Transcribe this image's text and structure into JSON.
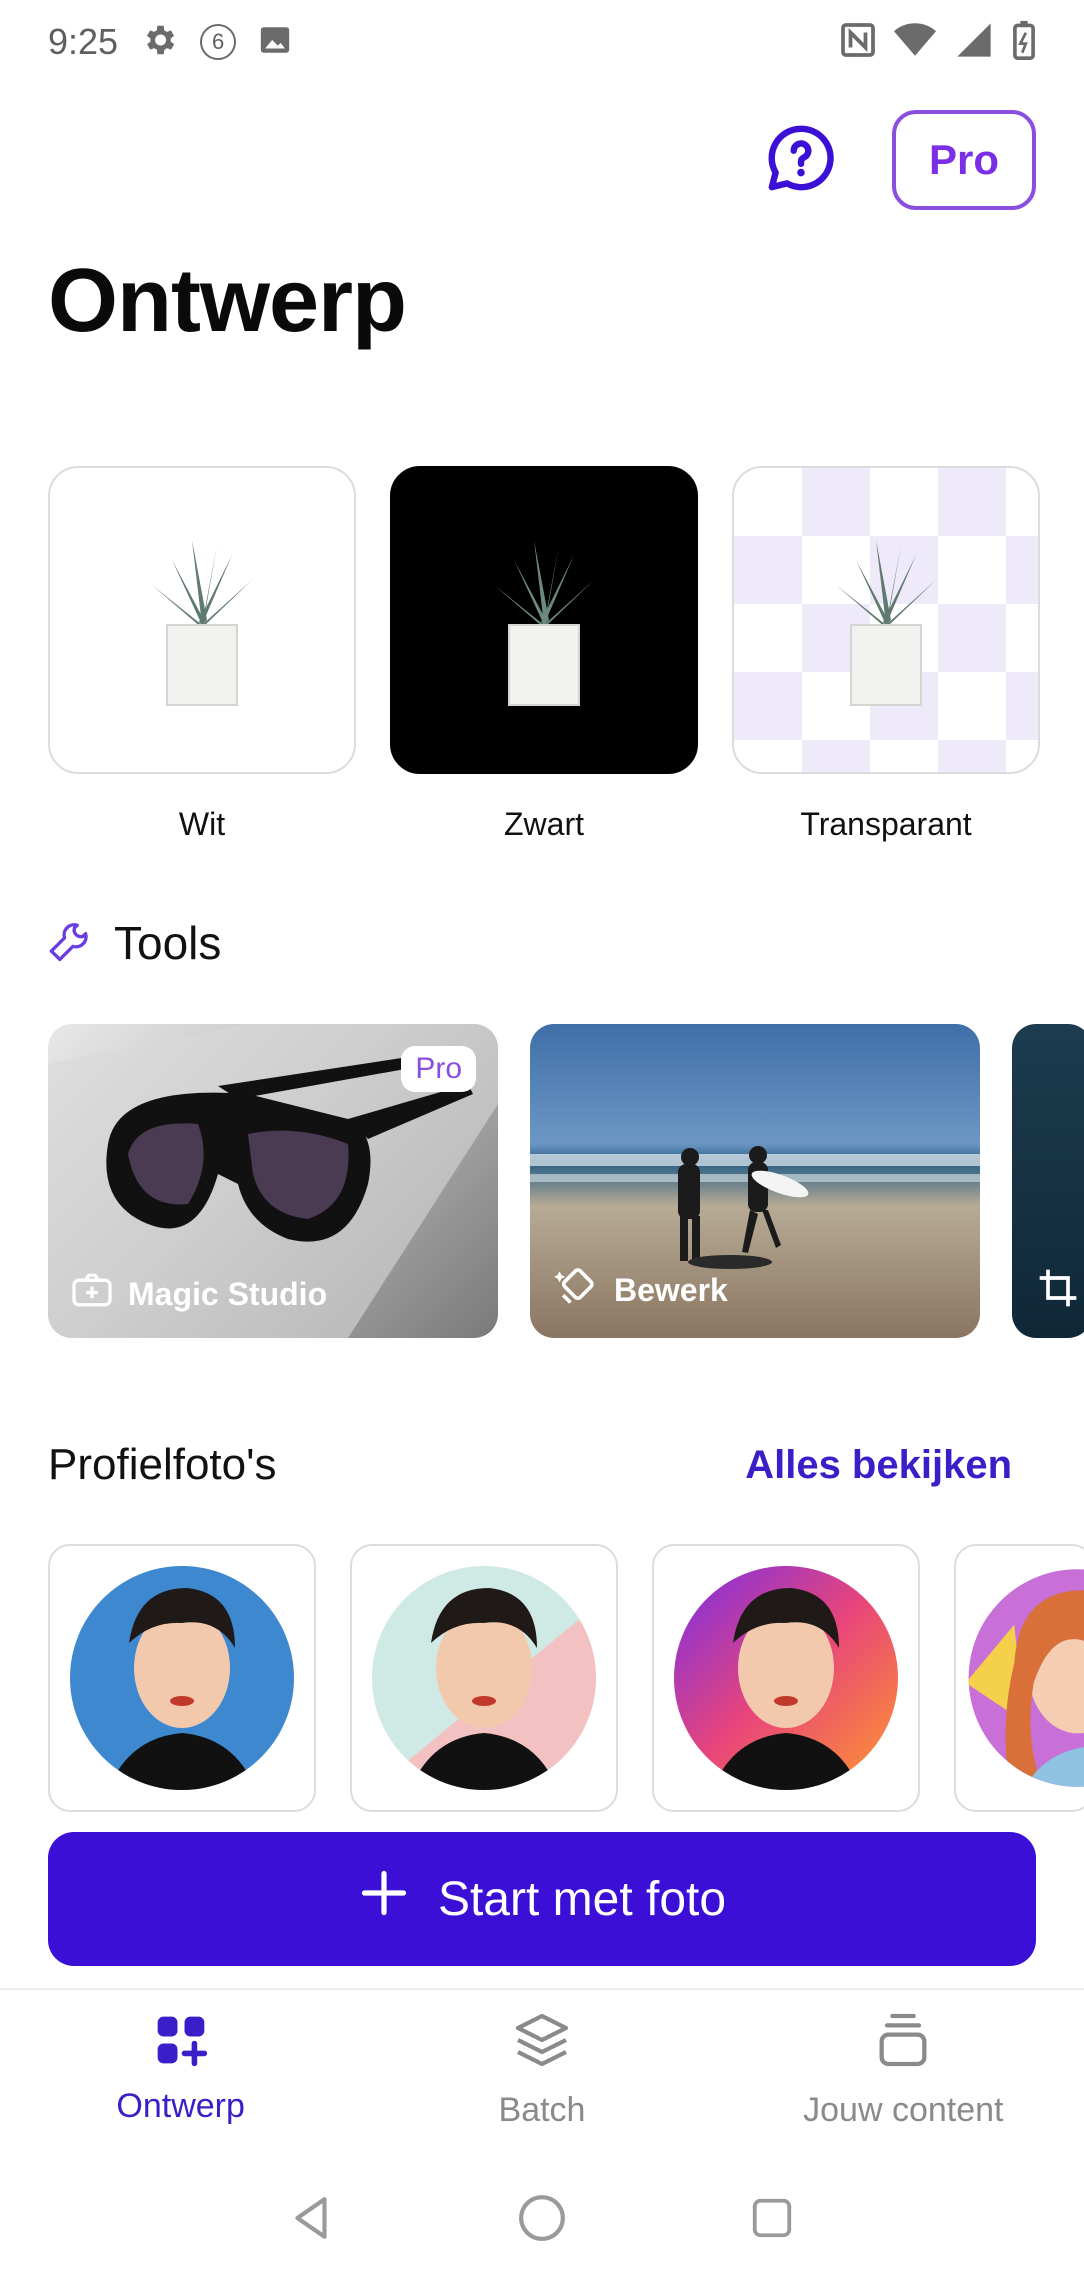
{
  "status_bar": {
    "time": "9:25",
    "notification_count": "6",
    "icons_left": [
      "settings-icon",
      "notification-count-icon",
      "image-icon"
    ],
    "icons_right": [
      "nfc-icon",
      "wifi-icon",
      "signal-icon",
      "battery-icon"
    ]
  },
  "header": {
    "title": "Ontwerp",
    "pro_label": "Pro",
    "help_icon": "help-chat-icon"
  },
  "backgrounds": [
    {
      "label": "Wit"
    },
    {
      "label": "Zwart"
    },
    {
      "label": "Transparant"
    }
  ],
  "tools": {
    "heading": "Tools",
    "cards": [
      {
        "label": "Magic Studio",
        "badge": "Pro",
        "icon": "magic-studio-icon"
      },
      {
        "label": "Bewerk",
        "icon": "eraser-edit-icon"
      },
      {
        "label": "",
        "icon": "crop-icon"
      }
    ]
  },
  "profile_photos": {
    "title": "Profielfoto's",
    "see_all": "Alles bekijken"
  },
  "start_button": {
    "label": "Start met foto"
  },
  "bottom_nav": [
    {
      "label": "Ontwerp",
      "active": true
    },
    {
      "label": "Batch",
      "active": false
    },
    {
      "label": "Jouw content",
      "active": false
    }
  ],
  "colors": {
    "accent": "#3b0fd6",
    "pro_purple": "#8b4fe0",
    "link": "#3a1fc8"
  }
}
